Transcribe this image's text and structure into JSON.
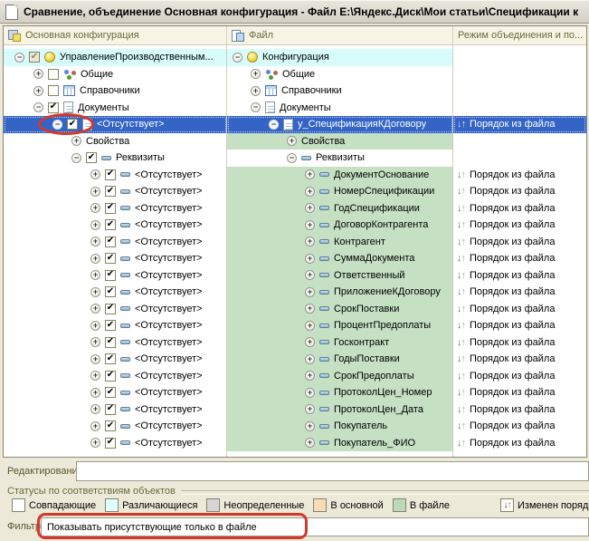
{
  "window": {
    "title": "Сравнение, объединение Основная конфигурация - Файл E:\\Яндекс.Диск\\Мои статьи\\Спецификации к"
  },
  "columns": {
    "main": "Основная конфигурация",
    "file": "Файл",
    "mode": "Режим объединения и по..."
  },
  "colors": {
    "selection_blue": "#3464C6",
    "row_cyan": "#D8FBFB",
    "row_green": "#C5E0C3",
    "annotation_red": "#D5382A"
  },
  "rows": [
    {
      "selected": false,
      "mode": null,
      "left": {
        "level": 0,
        "exp": "minus",
        "check": "gray",
        "icon": "ball",
        "text": "УправлениеПроизводственным...",
        "bg": "cyan"
      },
      "right": {
        "level": 0,
        "exp": "minus",
        "check": null,
        "icon": "ball",
        "text": "Конфигурация",
        "bg": "cyan"
      }
    },
    {
      "selected": false,
      "mode": null,
      "left": {
        "level": 1,
        "exp": "plus",
        "check": "off",
        "icon": "dots",
        "text": "Общие",
        "bg": "white"
      },
      "right": {
        "level": 1,
        "exp": "plus",
        "check": null,
        "icon": "dots",
        "text": "Общие",
        "bg": "white"
      }
    },
    {
      "selected": false,
      "mode": null,
      "left": {
        "level": 1,
        "exp": "plus",
        "check": "off",
        "icon": "table",
        "text": "Справочники",
        "bg": "white"
      },
      "right": {
        "level": 1,
        "exp": "plus",
        "check": null,
        "icon": "table",
        "text": "Справочники",
        "bg": "white"
      }
    },
    {
      "selected": false,
      "mode": null,
      "left": {
        "level": 1,
        "exp": "minus",
        "check": "on",
        "icon": "doc",
        "text": "Документы",
        "bg": "white"
      },
      "right": {
        "level": 1,
        "exp": "minus",
        "check": null,
        "icon": "doc",
        "text": "Документы",
        "bg": "white"
      }
    },
    {
      "selected": true,
      "mode": "Порядок из файла",
      "left": {
        "level": 2,
        "exp": "minus",
        "check": "on",
        "icon": "doc",
        "text": "<Отсутствует>",
        "bg": "white"
      },
      "right": {
        "level": 2,
        "exp": "minus",
        "check": null,
        "icon": "doc",
        "text": "у_СпецификацияКДоговору",
        "bg": "white"
      }
    },
    {
      "selected": false,
      "mode": null,
      "left": {
        "level": 3,
        "exp": "plus",
        "check": null,
        "icon": null,
        "text": "Свойства",
        "bg": "white"
      },
      "right": {
        "level": 3,
        "exp": "plus",
        "check": null,
        "icon": null,
        "text": "Свойства",
        "bg": "green"
      }
    },
    {
      "selected": false,
      "mode": null,
      "left": {
        "level": 3,
        "exp": "minus",
        "check": "on",
        "icon": "dash",
        "text": "Реквизиты",
        "bg": "white"
      },
      "right": {
        "level": 3,
        "exp": "minus",
        "check": null,
        "icon": "dash",
        "text": "Реквизиты",
        "bg": "white"
      }
    },
    {
      "selected": false,
      "mode": "Порядок из файла",
      "left": {
        "level": 4,
        "exp": "plus",
        "check": "on",
        "icon": "dash",
        "text": "<Отсутствует>",
        "bg": "white"
      },
      "right": {
        "level": 4,
        "exp": "plus",
        "check": null,
        "icon": "dash",
        "text": "ДокументОснование",
        "bg": "green"
      }
    },
    {
      "selected": false,
      "mode": "Порядок из файла",
      "left": {
        "level": 4,
        "exp": "plus",
        "check": "on",
        "icon": "dash",
        "text": "<Отсутствует>",
        "bg": "white"
      },
      "right": {
        "level": 4,
        "exp": "plus",
        "check": null,
        "icon": "dash",
        "text": "НомерСпецификации",
        "bg": "green"
      }
    },
    {
      "selected": false,
      "mode": "Порядок из файла",
      "left": {
        "level": 4,
        "exp": "plus",
        "check": "on",
        "icon": "dash",
        "text": "<Отсутствует>",
        "bg": "white"
      },
      "right": {
        "level": 4,
        "exp": "plus",
        "check": null,
        "icon": "dash",
        "text": "ГодСпецификации",
        "bg": "green"
      }
    },
    {
      "selected": false,
      "mode": "Порядок из файла",
      "left": {
        "level": 4,
        "exp": "plus",
        "check": "on",
        "icon": "dash",
        "text": "<Отсутствует>",
        "bg": "white"
      },
      "right": {
        "level": 4,
        "exp": "plus",
        "check": null,
        "icon": "dash",
        "text": "ДоговорКонтрагента",
        "bg": "green"
      }
    },
    {
      "selected": false,
      "mode": "Порядок из файла",
      "left": {
        "level": 4,
        "exp": "plus",
        "check": "on",
        "icon": "dash",
        "text": "<Отсутствует>",
        "bg": "white"
      },
      "right": {
        "level": 4,
        "exp": "plus",
        "check": null,
        "icon": "dash",
        "text": "Контрагент",
        "bg": "green"
      }
    },
    {
      "selected": false,
      "mode": "Порядок из файла",
      "left": {
        "level": 4,
        "exp": "plus",
        "check": "on",
        "icon": "dash",
        "text": "<Отсутствует>",
        "bg": "white"
      },
      "right": {
        "level": 4,
        "exp": "plus",
        "check": null,
        "icon": "dash",
        "text": "СуммаДокумента",
        "bg": "green"
      }
    },
    {
      "selected": false,
      "mode": "Порядок из файла",
      "left": {
        "level": 4,
        "exp": "plus",
        "check": "on",
        "icon": "dash",
        "text": "<Отсутствует>",
        "bg": "white"
      },
      "right": {
        "level": 4,
        "exp": "plus",
        "check": null,
        "icon": "dash",
        "text": "Ответственный",
        "bg": "green"
      }
    },
    {
      "selected": false,
      "mode": "Порядок из файла",
      "left": {
        "level": 4,
        "exp": "plus",
        "check": "on",
        "icon": "dash",
        "text": "<Отсутствует>",
        "bg": "white"
      },
      "right": {
        "level": 4,
        "exp": "plus",
        "check": null,
        "icon": "dash",
        "text": "ПриложениеКДоговору",
        "bg": "green"
      }
    },
    {
      "selected": false,
      "mode": "Порядок из файла",
      "left": {
        "level": 4,
        "exp": "plus",
        "check": "on",
        "icon": "dash",
        "text": "<Отсутствует>",
        "bg": "white"
      },
      "right": {
        "level": 4,
        "exp": "plus",
        "check": null,
        "icon": "dash",
        "text": "СрокПоставки",
        "bg": "green"
      }
    },
    {
      "selected": false,
      "mode": "Порядок из файла",
      "left": {
        "level": 4,
        "exp": "plus",
        "check": "on",
        "icon": "dash",
        "text": "<Отсутствует>",
        "bg": "white"
      },
      "right": {
        "level": 4,
        "exp": "plus",
        "check": null,
        "icon": "dash",
        "text": "ПроцентПредоплаты",
        "bg": "green"
      }
    },
    {
      "selected": false,
      "mode": "Порядок из файла",
      "left": {
        "level": 4,
        "exp": "plus",
        "check": "on",
        "icon": "dash",
        "text": "<Отсутствует>",
        "bg": "white"
      },
      "right": {
        "level": 4,
        "exp": "plus",
        "check": null,
        "icon": "dash",
        "text": "Госконтракт",
        "bg": "green"
      }
    },
    {
      "selected": false,
      "mode": "Порядок из файла",
      "left": {
        "level": 4,
        "exp": "plus",
        "check": "on",
        "icon": "dash",
        "text": "<Отсутствует>",
        "bg": "white"
      },
      "right": {
        "level": 4,
        "exp": "plus",
        "check": null,
        "icon": "dash",
        "text": "ГодыПоставки",
        "bg": "green"
      }
    },
    {
      "selected": false,
      "mode": "Порядок из файла",
      "left": {
        "level": 4,
        "exp": "plus",
        "check": "on",
        "icon": "dash",
        "text": "<Отсутствует>",
        "bg": "white"
      },
      "right": {
        "level": 4,
        "exp": "plus",
        "check": null,
        "icon": "dash",
        "text": "СрокПредоплаты",
        "bg": "green"
      }
    },
    {
      "selected": false,
      "mode": "Порядок из файла",
      "left": {
        "level": 4,
        "exp": "plus",
        "check": "on",
        "icon": "dash",
        "text": "<Отсутствует>",
        "bg": "white"
      },
      "right": {
        "level": 4,
        "exp": "plus",
        "check": null,
        "icon": "dash",
        "text": "ПротоколЦен_Номер",
        "bg": "green"
      }
    },
    {
      "selected": false,
      "mode": "Порядок из файла",
      "left": {
        "level": 4,
        "exp": "plus",
        "check": "on",
        "icon": "dash",
        "text": "<Отсутствует>",
        "bg": "white"
      },
      "right": {
        "level": 4,
        "exp": "plus",
        "check": null,
        "icon": "dash",
        "text": "ПротоколЦен_Дата",
        "bg": "green"
      }
    },
    {
      "selected": false,
      "mode": "Порядок из файла",
      "left": {
        "level": 4,
        "exp": "plus",
        "check": "on",
        "icon": "dash",
        "text": "<Отсутствует>",
        "bg": "white"
      },
      "right": {
        "level": 4,
        "exp": "plus",
        "check": null,
        "icon": "dash",
        "text": "Покупатель",
        "bg": "green"
      }
    },
    {
      "selected": false,
      "mode": "Порядок из файла",
      "left": {
        "level": 4,
        "exp": "plus",
        "check": "on",
        "icon": "dash",
        "text": "<Отсутствует>",
        "bg": "white"
      },
      "right": {
        "level": 4,
        "exp": "plus",
        "check": null,
        "icon": "dash",
        "text": "Покупатель_ФИО",
        "bg": "green"
      }
    }
  ],
  "editing": {
    "label": "Редактирование:",
    "value": ""
  },
  "statuses": {
    "group_label": "Статусы по соответствиям объектов",
    "legend": [
      {
        "label": "Совпадающие",
        "color": "#FFFFFF"
      },
      {
        "label": "Различающиеся",
        "color": "#E2FFFF"
      },
      {
        "label": "Неопределенные",
        "color": "#D5D5D5"
      },
      {
        "label": "В основной",
        "color": "#F9DCB6"
      },
      {
        "label": "В файле",
        "color": "#BDD9BC"
      }
    ],
    "order_changed_label": "Изменен порядок"
  },
  "filter": {
    "label": "Фильтр:",
    "value": "Показывать присутствующие только в файле"
  }
}
